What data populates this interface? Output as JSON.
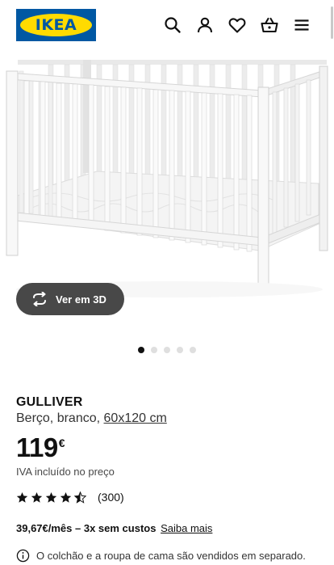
{
  "header": {
    "logo_text": "IKEA",
    "icons": [
      "search-icon",
      "user-icon",
      "heart-icon",
      "basket-icon",
      "menu-icon"
    ]
  },
  "gallery": {
    "button_3d_label": "Ver em 3D",
    "dots_total": 5,
    "dots_active": 1
  },
  "product": {
    "name": "GULLIVER",
    "description": "Berço, branco,",
    "size_link": "60x120 cm",
    "price": "119",
    "currency": "€",
    "vat_note": "IVA incluído no preço",
    "rating_value": 4.5,
    "rating_count": "(300)",
    "finance_bold": "39,67€/mês – 3x sem custos",
    "finance_link": "Saiba mais",
    "notice": "O colchão e a roupa de cama são vendidos em separado."
  },
  "colors": {
    "ikea_blue": "#0058a3",
    "ikea_yellow": "#ffdb00",
    "button_dark": "#484848"
  }
}
